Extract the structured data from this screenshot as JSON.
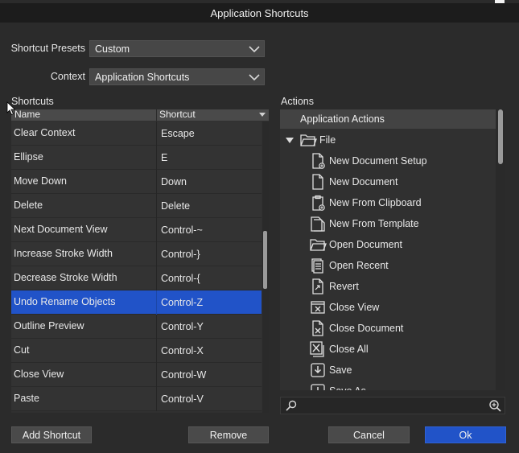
{
  "window": {
    "title": "Application Shortcuts"
  },
  "form": {
    "presets_label": "Shortcut Presets",
    "presets_value": "Custom",
    "context_label": "Context",
    "context_value": "Application Shortcuts"
  },
  "shortcuts": {
    "section_label": "Shortcuts",
    "columns": [
      "Name",
      "Shortcut"
    ],
    "rows": [
      {
        "name": "Clear Context",
        "key": "Escape"
      },
      {
        "name": "Ellipse",
        "key": "E"
      },
      {
        "name": "Move Down",
        "key": "Down"
      },
      {
        "name": "Delete",
        "key": "Delete"
      },
      {
        "name": "Next Document View",
        "key": "Control-~"
      },
      {
        "name": "Increase Stroke Width",
        "key": "Control-}"
      },
      {
        "name": "Decrease Stroke Width",
        "key": "Control-{"
      },
      {
        "name": "Undo Rename Objects",
        "key": "Control-Z",
        "selected": true
      },
      {
        "name": "Outline Preview",
        "key": "Control-Y"
      },
      {
        "name": "Cut",
        "key": "Control-X"
      },
      {
        "name": "Close View",
        "key": "Control-W"
      },
      {
        "name": "Paste",
        "key": "Control-V"
      }
    ]
  },
  "actions": {
    "section_label": "Actions",
    "root": "Application Actions",
    "folder": {
      "label": "File",
      "icon": "folder-open-icon"
    },
    "items": [
      {
        "label": "New Document Setup",
        "icon": "new-document-setup-icon"
      },
      {
        "label": "New Document",
        "icon": "new-document-icon"
      },
      {
        "label": "New From Clipboard",
        "icon": "new-from-clipboard-icon"
      },
      {
        "label": "New From Template",
        "icon": "new-from-template-icon"
      },
      {
        "label": "Open Document",
        "icon": "open-document-icon"
      },
      {
        "label": "Open Recent",
        "icon": "open-recent-icon"
      },
      {
        "label": "Revert",
        "icon": "revert-icon"
      },
      {
        "label": "Close View",
        "icon": "close-view-icon"
      },
      {
        "label": "Close Document",
        "icon": "close-document-icon"
      },
      {
        "label": "Close All",
        "icon": "close-all-icon"
      },
      {
        "label": "Save",
        "icon": "save-icon"
      },
      {
        "label": "Save As",
        "icon": "save-as-icon"
      }
    ],
    "search_placeholder": ""
  },
  "buttons": {
    "add_shortcut": "Add Shortcut",
    "remove": "Remove",
    "cancel": "Cancel",
    "ok": "Ok"
  },
  "colors": {
    "background": "#2b2b2b",
    "selection": "#2153c8",
    "primary_button": "#2153c8"
  }
}
